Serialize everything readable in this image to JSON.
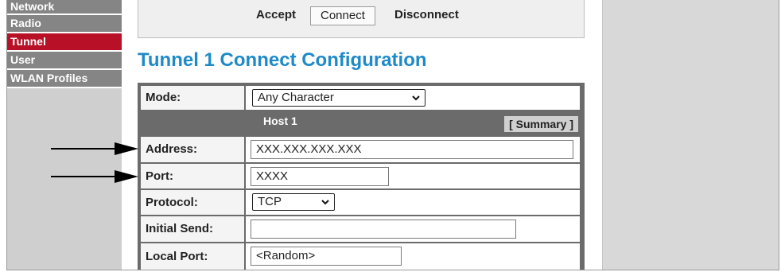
{
  "sidebar": {
    "items": [
      {
        "label": "Network",
        "active": false
      },
      {
        "label": "Radio",
        "active": false
      },
      {
        "label": "Tunnel",
        "active": true
      },
      {
        "label": "User",
        "active": false
      },
      {
        "label": "WLAN Profiles",
        "active": false
      }
    ]
  },
  "actions": {
    "accept": "Accept",
    "connect": "Connect",
    "disconnect": "Disconnect"
  },
  "page_title": "Tunnel 1 Connect Configuration",
  "form": {
    "mode": {
      "label": "Mode:",
      "value": "Any Character"
    },
    "host": {
      "title": "Host 1",
      "summary": "[ Summary ]"
    },
    "address": {
      "label": "Address:",
      "value": "XXX.XXX.XXX.XXX"
    },
    "port": {
      "label": "Port:",
      "value": "XXXX"
    },
    "protocol": {
      "label": "Protocol:",
      "value": "TCP"
    },
    "initial_send": {
      "label": "Initial Send:",
      "value": ""
    },
    "local_port": {
      "label": "Local Port:",
      "value": "<Random>"
    }
  },
  "colors": {
    "active_nav": "#b81127",
    "title_blue": "#1f8ac8"
  }
}
